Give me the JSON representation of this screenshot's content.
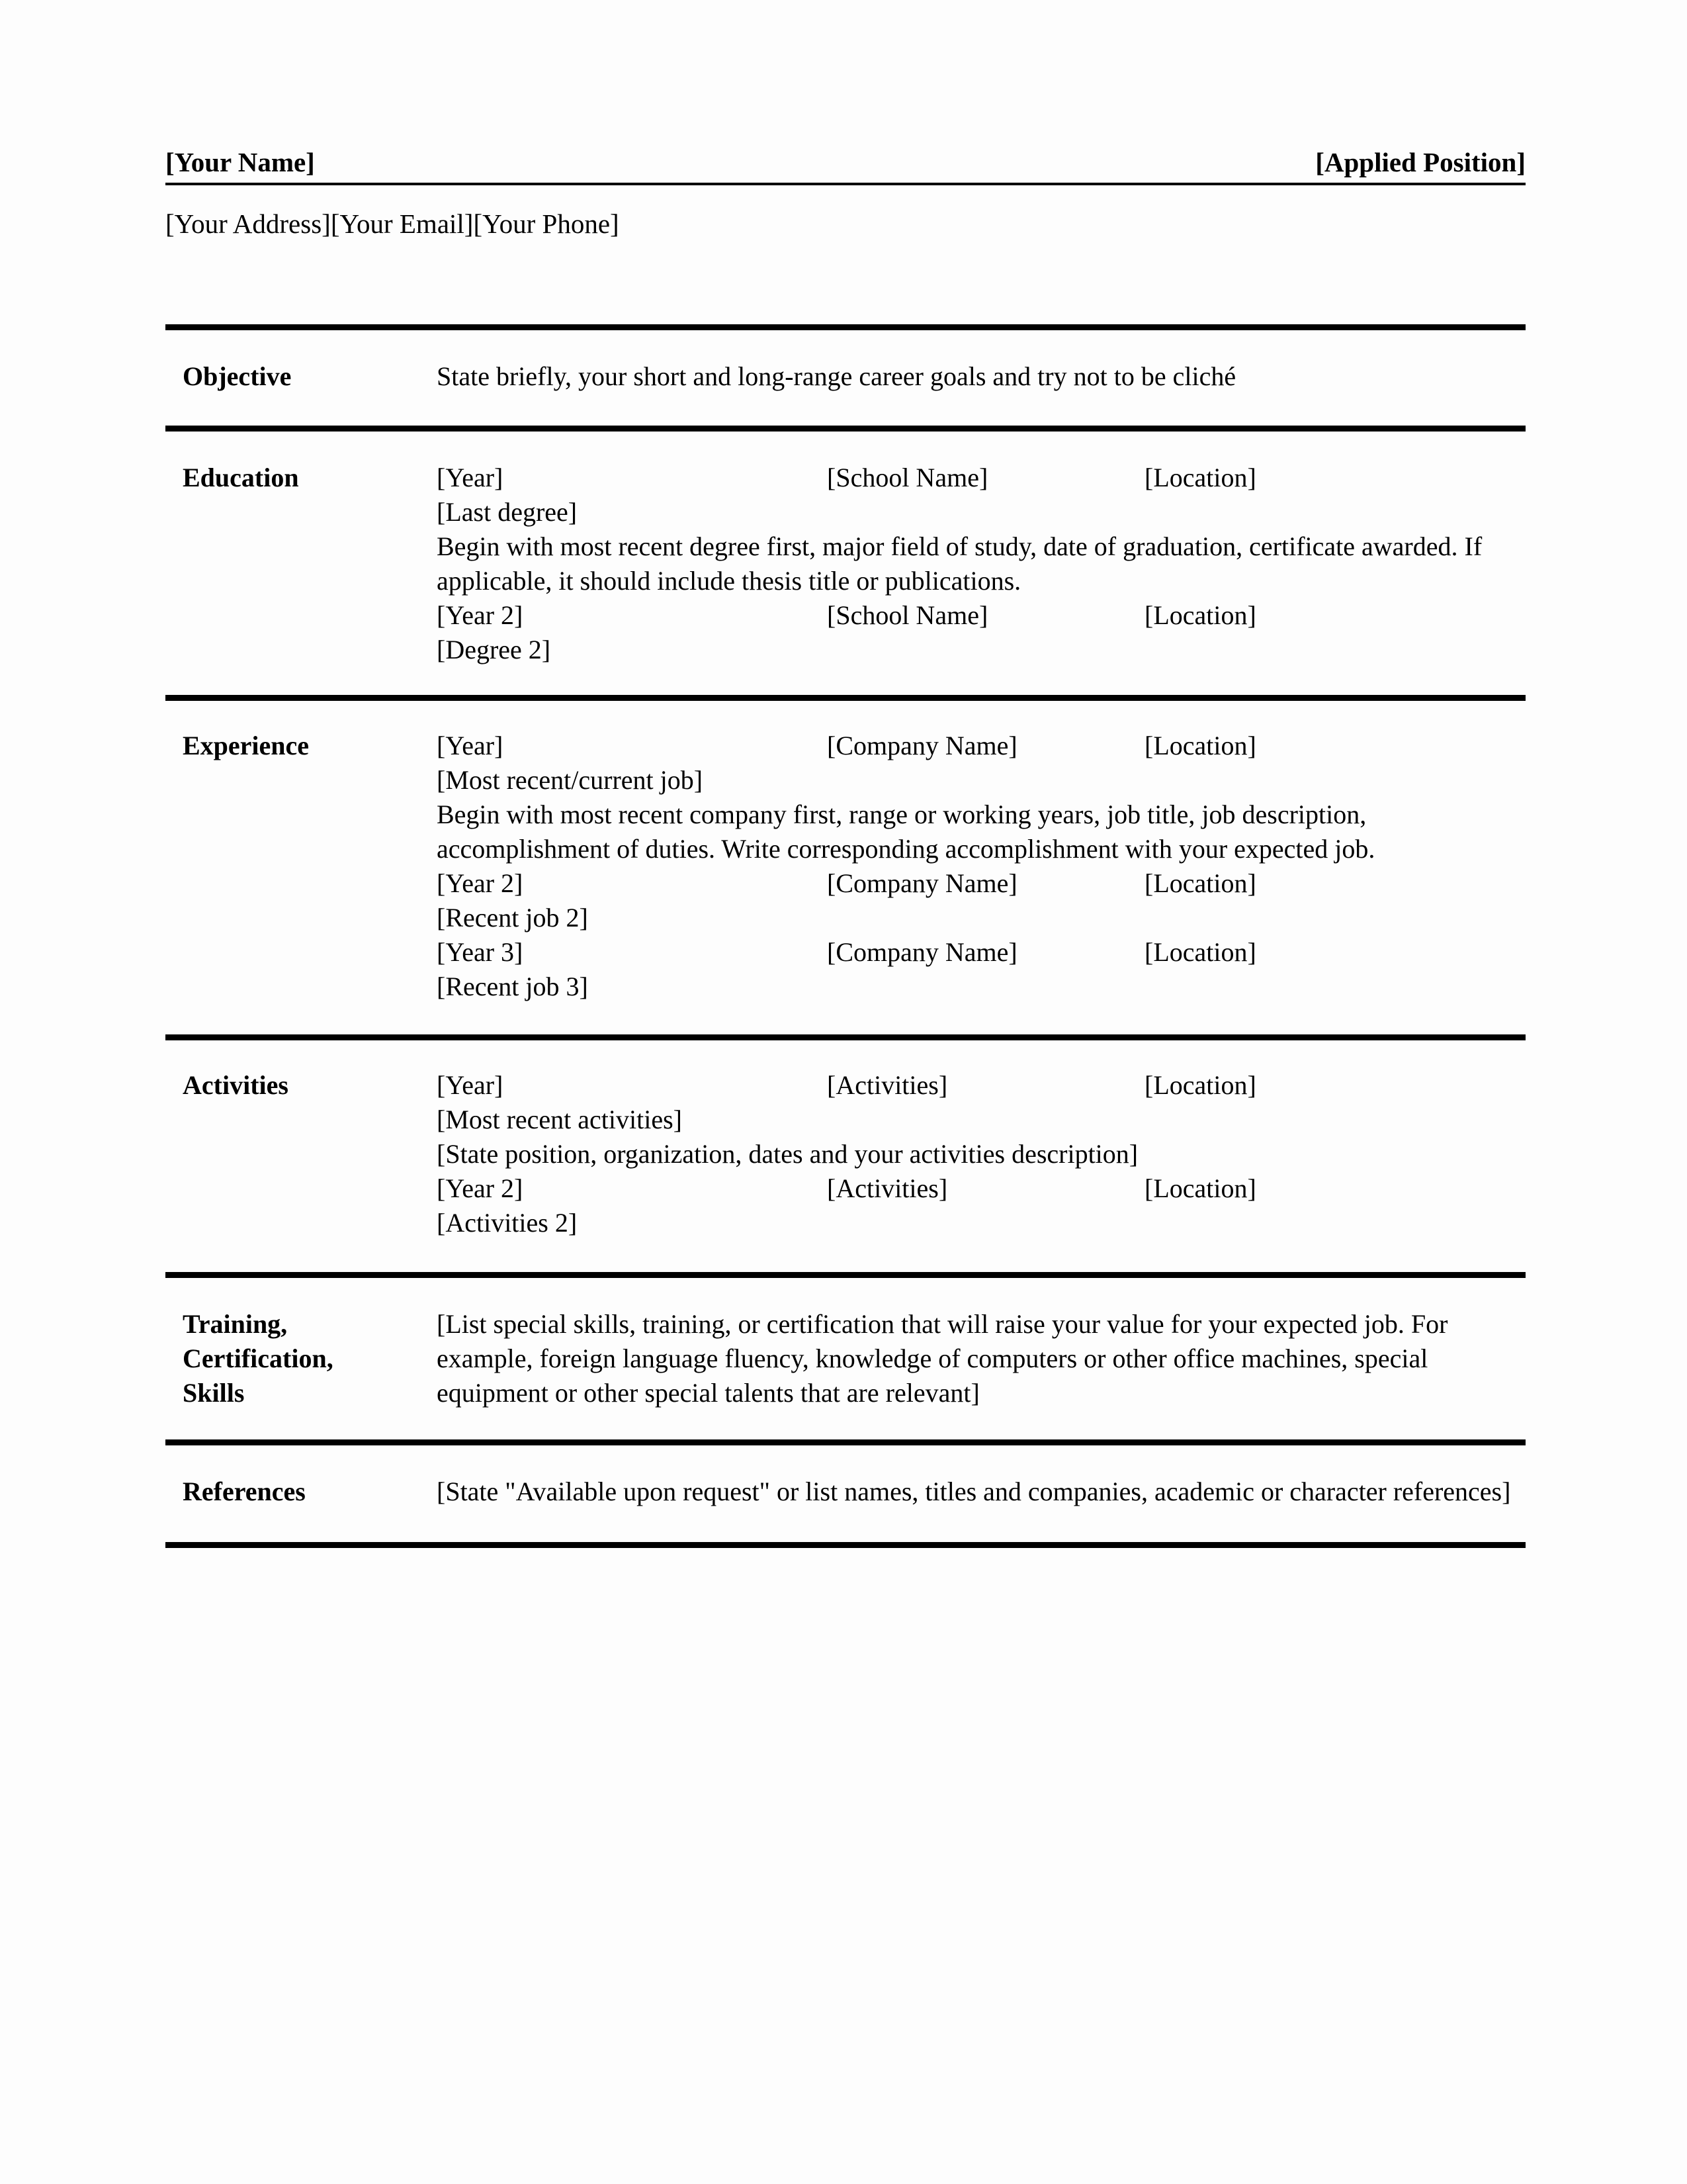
{
  "header": {
    "name": "[Your Name]",
    "applied_position": "[Applied Position]",
    "contact_line": "[Your Address][Your Email][Your Phone]"
  },
  "sections": {
    "objective": {
      "label": "Objective",
      "text": "State briefly, your short and long-range career goals and try not to be cliché"
    },
    "education": {
      "label": "Education",
      "entry1": {
        "year": "[Year]",
        "org": "[School Name]",
        "location": "[Location]"
      },
      "degree1": "[Last degree]",
      "description": "Begin with most recent degree first, major field of study, date of graduation, certificate awarded. If applicable, it should include thesis title or publications.",
      "entry2": {
        "year": "[Year 2]",
        "org": "[School Name]",
        "location": "[Location]"
      },
      "degree2": "[Degree 2]"
    },
    "experience": {
      "label": "Experience",
      "entry1": {
        "year": "[Year]",
        "org": "[Company Name]",
        "location": "[Location]"
      },
      "job1": "[Most recent/current job]",
      "description": "Begin with most recent company first, range or working years, job title, job description, accomplishment of duties. Write corresponding accomplishment with your expected job.",
      "entry2": {
        "year": "[Year 2]",
        "org": "[Company Name]",
        "location": "[Location]"
      },
      "job2": "[Recent job 2]",
      "entry3": {
        "year": "[Year 3]",
        "org": "[Company Name]",
        "location": "[Location]"
      },
      "job3": "[Recent job 3]"
    },
    "activities": {
      "label": "Activities",
      "entry1": {
        "year": "[Year]",
        "org": "[Activities]",
        "location": "[Location]"
      },
      "activity1": "[Most recent activities]",
      "description": "[State position, organization, dates  and your activities description]",
      "entry2": {
        "year": "[Year 2]",
        "org": "[Activities]",
        "location": "[Location]"
      },
      "activity2": "[Activities 2]"
    },
    "training": {
      "label_line1": "Training,",
      "label_line2": "Certification,",
      "label_line3": "Skills",
      "text": "[List special skills, training, or certification that will raise your value for your expected job. For example, foreign language fluency, knowledge of computers or other office machines, special equipment or other special talents that are relevant]"
    },
    "references": {
      "label": "References",
      "text": "[State \"Available upon request\" or list names, titles and companies, academic or character references]"
    }
  }
}
